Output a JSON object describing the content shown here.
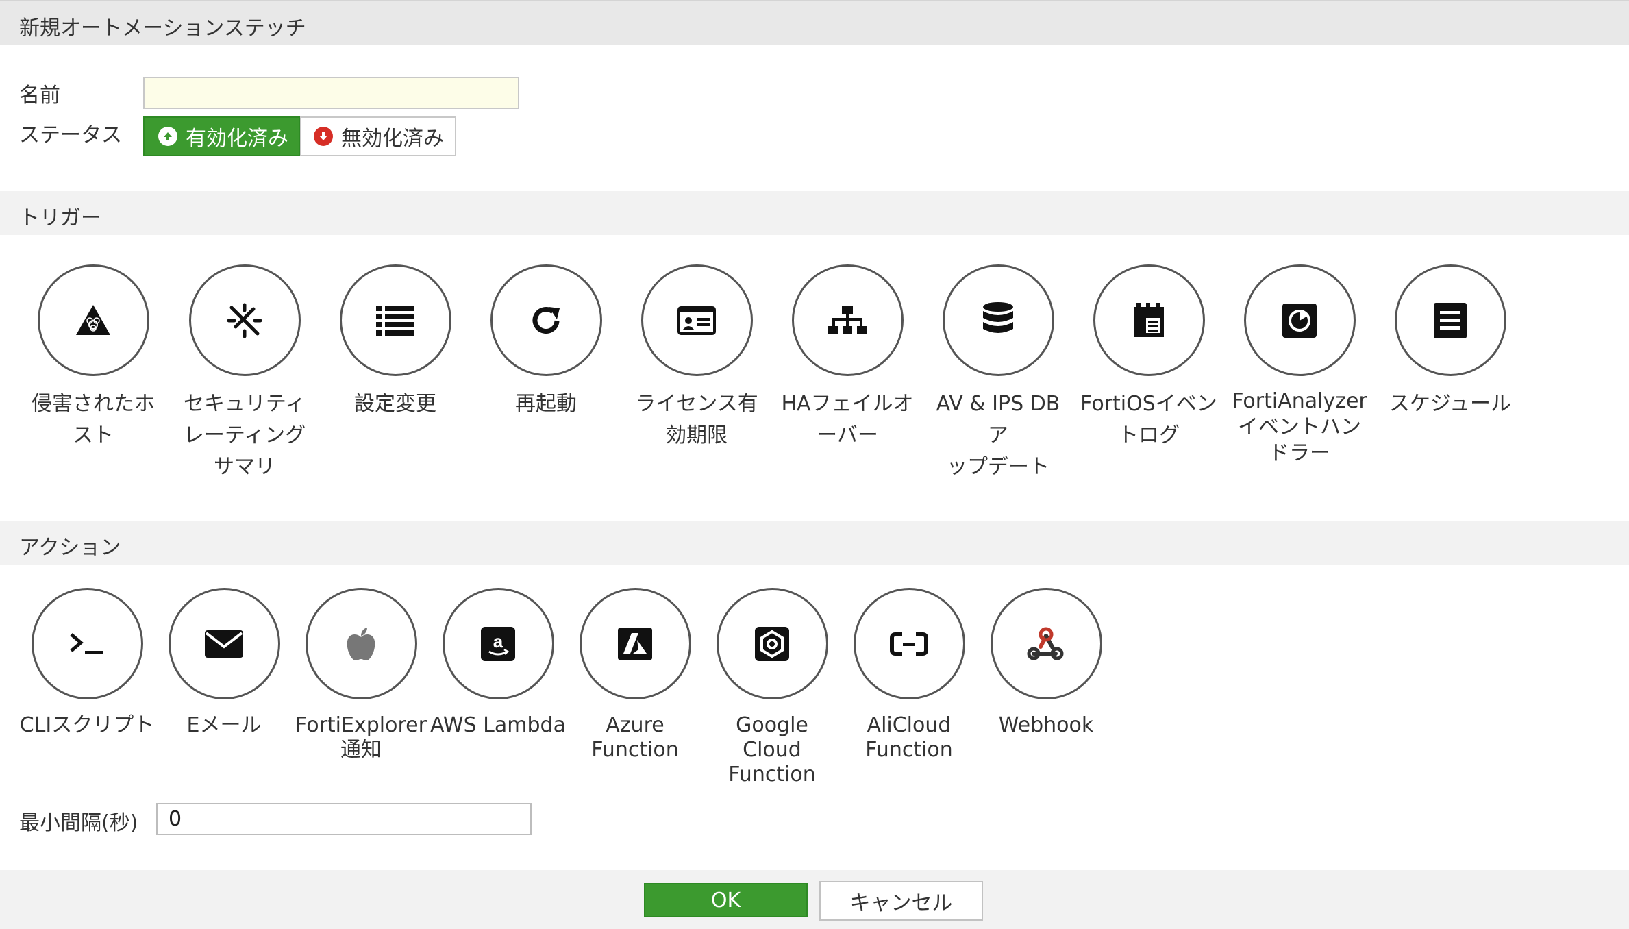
{
  "dialog": {
    "title": "新規オートメーションステッチ"
  },
  "form": {
    "name_label": "名前",
    "name_value": "",
    "status_label": "ステータス",
    "status_enabled": "有効化済み",
    "status_disabled": "無効化済み"
  },
  "trigger": {
    "title": "トリガー",
    "items": [
      {
        "label": "侵害されたホ\nスト",
        "icon": "biohazard-icon"
      },
      {
        "label": "セキュリティ\nレーティング\nサマリ",
        "icon": "security-rating-icon"
      },
      {
        "label": "設定変更",
        "icon": "list-icon"
      },
      {
        "label": "再起動",
        "icon": "reboot-icon"
      },
      {
        "label": "ライセンス有\n効期限",
        "icon": "license-card-icon"
      },
      {
        "label": "HAフェイルオ\nーバー",
        "icon": "ha-sitemap-icon"
      },
      {
        "label": "AV & IPS DB ア\nップデート",
        "icon": "database-icon"
      },
      {
        "label": "FortiOSイベン\nトログ",
        "icon": "event-log-icon"
      },
      {
        "label": "FortiAnalyzer\nイベントハン\nドラー",
        "icon": "fortianalyzer-icon"
      },
      {
        "label": "スケジュール",
        "icon": "schedule-icon"
      }
    ]
  },
  "action": {
    "title": "アクション",
    "items": [
      {
        "label": "CLIスクリプト",
        "icon": "terminal-icon"
      },
      {
        "label": "Eメール",
        "icon": "envelope-icon"
      },
      {
        "label": "FortiExplorer\n通知",
        "icon": "apple-icon"
      },
      {
        "label": "AWS Lambda",
        "icon": "amazon-icon"
      },
      {
        "label": "Azure\nFunction",
        "icon": "azure-icon"
      },
      {
        "label": "Google Cloud\nFunction",
        "icon": "google-cloud-icon"
      },
      {
        "label": "AliCloud\nFunction",
        "icon": "alicloud-icon"
      },
      {
        "label": "Webhook",
        "icon": "webhook-icon"
      }
    ]
  },
  "interval": {
    "label": "最小間隔(秒)",
    "value": "0"
  },
  "footer": {
    "ok_label": "OK",
    "cancel_label": "キャンセル"
  },
  "colors": {
    "accent_green": "#3c9a2f",
    "disabled_red": "#d62e26",
    "webhook_red": "#c0392b"
  }
}
